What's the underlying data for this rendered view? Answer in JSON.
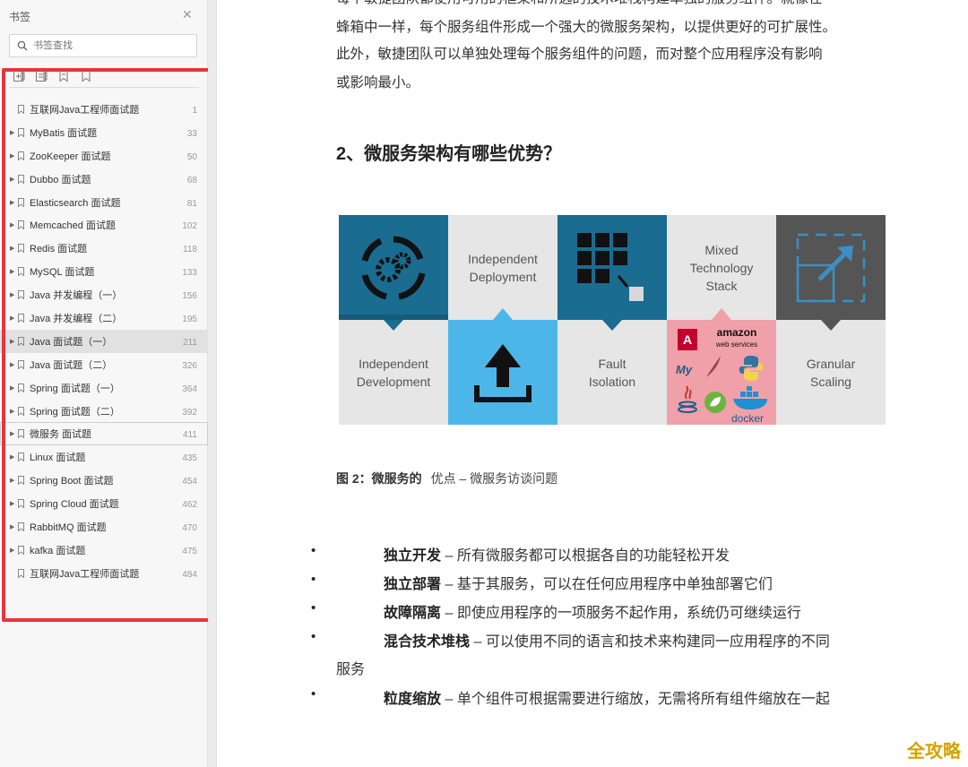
{
  "sidebar": {
    "title": "书签",
    "close_glyph": "✕",
    "search_placeholder": "书签查找",
    "tools": [
      "add-bookmark-icon",
      "expand-all-icon",
      "bookmark-icon",
      "bookmark-outline-icon"
    ],
    "items": [
      {
        "label": "互联网Java工程师面试题",
        "page": "1",
        "expandable": false
      },
      {
        "label": "MyBatis 面试题",
        "page": "33",
        "expandable": true
      },
      {
        "label": "ZooKeeper 面试题",
        "page": "50",
        "expandable": true
      },
      {
        "label": "Dubbo 面试题",
        "page": "68",
        "expandable": true
      },
      {
        "label": "Elasticsearch 面试题",
        "page": "81",
        "expandable": true
      },
      {
        "label": "Memcached 面试题",
        "page": "102",
        "expandable": true
      },
      {
        "label": "Redis 面试题",
        "page": "118",
        "expandable": true
      },
      {
        "label": "MySQL 面试题",
        "page": "133",
        "expandable": true
      },
      {
        "label": "Java 并发编程（一）",
        "page": "156",
        "expandable": true
      },
      {
        "label": "Java 并发编程（二）",
        "page": "195",
        "expandable": true
      },
      {
        "label": "Java 面试题（一）",
        "page": "211",
        "expandable": true,
        "selected": true
      },
      {
        "label": "Java 面试题（二）",
        "page": "326",
        "expandable": true
      },
      {
        "label": "Spring 面试题（一）",
        "page": "364",
        "expandable": true
      },
      {
        "label": "Spring 面试题（二）",
        "page": "392",
        "expandable": true
      },
      {
        "label": "微服务 面试题",
        "page": "411",
        "expandable": true,
        "outlined": true
      },
      {
        "label": "Linux 面试题",
        "page": "435",
        "expandable": true
      },
      {
        "label": "Spring Boot 面试题",
        "page": "454",
        "expandable": true
      },
      {
        "label": "Spring Cloud 面试题",
        "page": "462",
        "expandable": true
      },
      {
        "label": "RabbitMQ 面试题",
        "page": "470",
        "expandable": true
      },
      {
        "label": "kafka 面试题",
        "page": "475",
        "expandable": true
      },
      {
        "label": "互联网Java工程师面试题",
        "page": "484",
        "expandable": false
      }
    ]
  },
  "document": {
    "intro_lines": [
      "每个敏捷团队都使用可用的框架和所选的技术堆栈构建单独的服务组件。就像在",
      "蜂箱中一样，每个服务组件形成一个强大的微服务架构，以提供更好的可扩展性。",
      "此外，敏捷团队可以单独处理每个服务组件的问题，而对整个应用程序没有影响",
      "或影响最小。"
    ],
    "heading": "2、微服务架构有哪些优势？",
    "figure": {
      "independent_deployment": "Independent Deployment",
      "mixed_technology_stack": "Mixed Technology Stack",
      "independent_development": "Independent Development",
      "fault_isolation": "Fault Isolation",
      "granular_scaling": "Granular Scaling",
      "logo_amazon": "amazon",
      "logo_web_services": "web services",
      "logo_docker": "docker",
      "logo_angular": "A",
      "logo_mysql": "My"
    },
    "caption": {
      "prefix": "图 2：微服务的",
      "rest": "优点 – 微服务访谈问题"
    },
    "bullets": [
      {
        "term": "独立开发",
        "desc": "– 所有微服务都可以根据各自的功能轻松开发"
      },
      {
        "term": "独立部署",
        "desc": "– 基于其服务，可以在任何应用程序中单独部署它们"
      },
      {
        "term": "故障隔离",
        "desc": "– 即使应用程序的一项服务不起作用，系统仍可继续运行"
      },
      {
        "term": "混合技术堆栈",
        "desc": "– 可以使用不同的语言和技术来构建同一应用程序的不同"
      },
      {
        "term": "粒度缩放",
        "desc": "– 单个组件可根据需要进行缩放，无需将所有组件缩放在一起"
      }
    ],
    "bullet_continuation": "服务",
    "bullet_glyph": "•"
  },
  "watermark": "全攻略",
  "colors": {
    "highlight_box": "#e8343c",
    "teal_dark": "#1a6c91",
    "sky": "#4cb6e9",
    "pink": "#f0a0a8",
    "charcoal": "#555555",
    "tile_light": "#e6e6e6"
  }
}
